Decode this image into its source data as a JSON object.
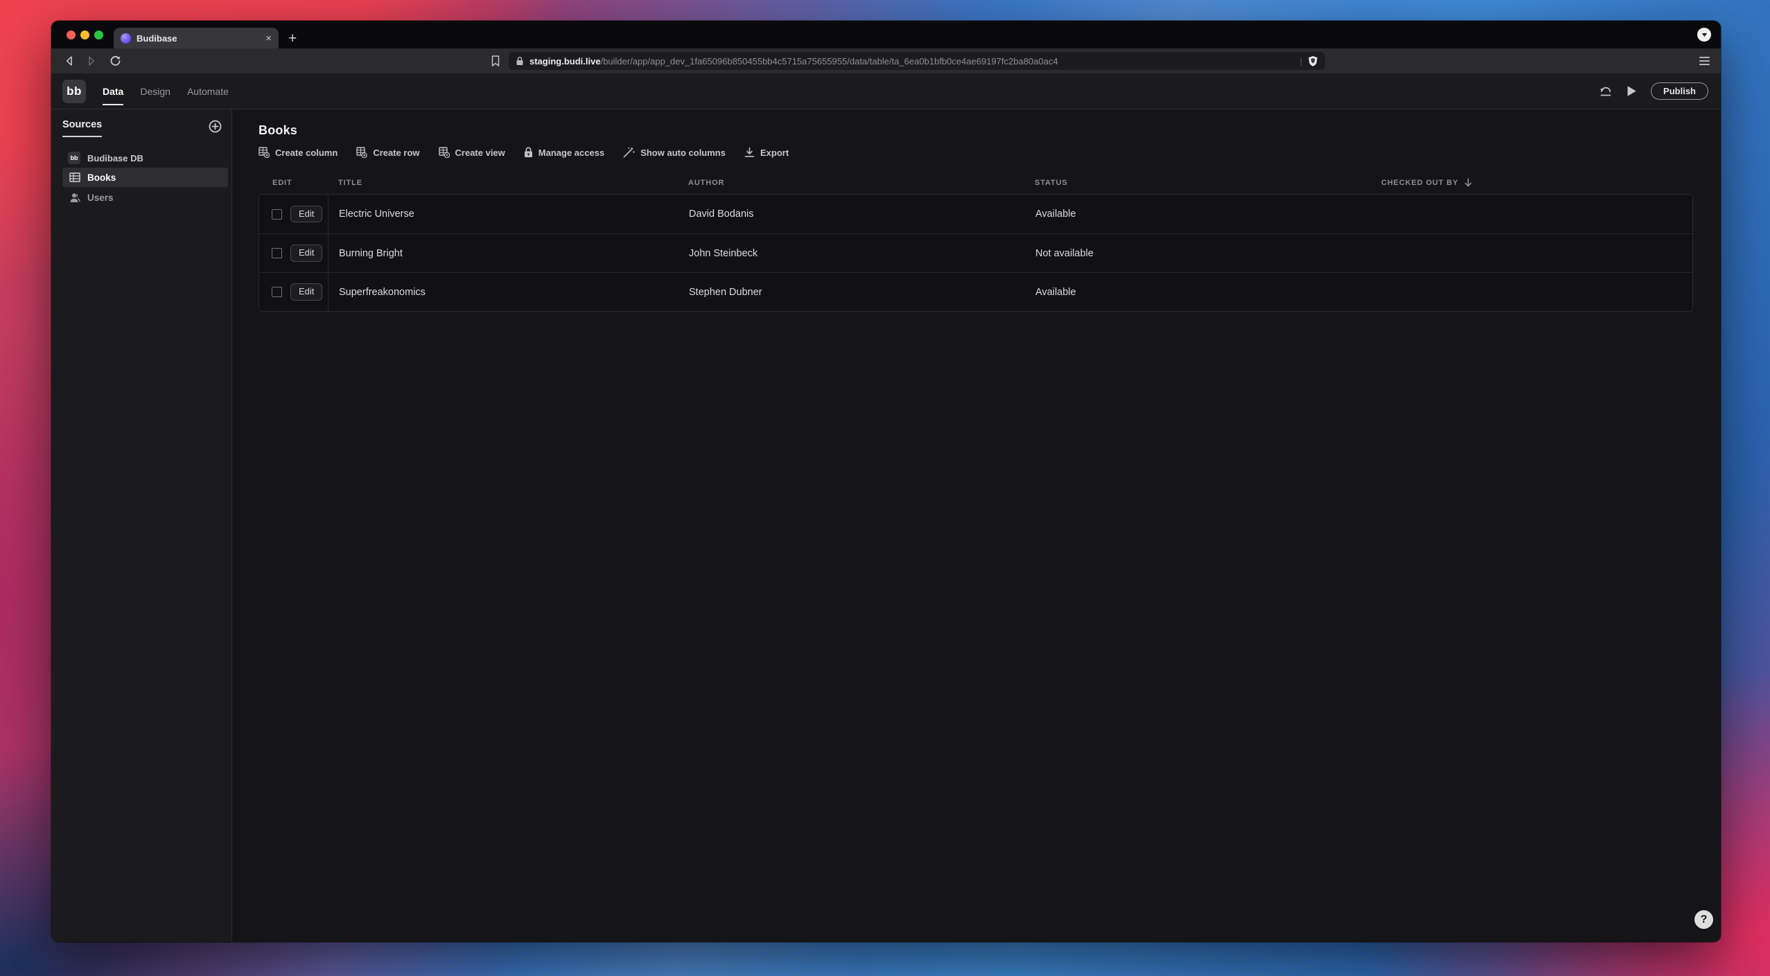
{
  "browser": {
    "tab_title": "Budibase",
    "close_tab_label": "×",
    "new_tab_label": "+",
    "url_domain": "staging.budi.live",
    "url_path": "/builder/app/app_dev_1fa65096b850455bb4c5715a75655955/data/table/ta_6ea0b1bfb0ce4ae69197fc2ba80a0ac4",
    "url_separator": "|"
  },
  "colors": {
    "traffic_close": "#ff5f57",
    "traffic_minimize": "#febc2e",
    "traffic_zoom": "#28c840",
    "favicon": "#6e5cf6",
    "selected_item_bg": "#2f2f33"
  },
  "app": {
    "logo_text": "bb",
    "nav": {
      "tabs": [
        {
          "label": "Data",
          "active": true
        },
        {
          "label": "Design",
          "active": false
        },
        {
          "label": "Automate",
          "active": false
        }
      ]
    },
    "publish_label": "Publish"
  },
  "sidebar": {
    "title": "Sources",
    "datasource": {
      "label": "Budibase DB",
      "icon_text": "bb"
    },
    "items": [
      {
        "label": "Books",
        "selected": true
      },
      {
        "label": "Users",
        "selected": false
      }
    ]
  },
  "main": {
    "title": "Books",
    "toolbar": [
      {
        "label": "Create column"
      },
      {
        "label": "Create row"
      },
      {
        "label": "Create view"
      },
      {
        "label": "Manage access"
      },
      {
        "label": "Show auto columns"
      },
      {
        "label": "Export"
      }
    ],
    "table": {
      "columns": [
        "EDIT",
        "TITLE",
        "AUTHOR",
        "STATUS",
        "CHECKED OUT BY"
      ],
      "sorted_column": "CHECKED OUT BY",
      "sort_direction": "descending",
      "edit_button_label": "Edit",
      "rows": [
        {
          "title": "Electric Universe",
          "author": "David Bodanis",
          "status": "Available",
          "checked_out_by": ""
        },
        {
          "title": "Burning Bright",
          "author": "John Steinbeck",
          "status": "Not available",
          "checked_out_by": ""
        },
        {
          "title": "Superfreakonomics",
          "author": "Stephen Dubner",
          "status": "Available",
          "checked_out_by": ""
        }
      ]
    },
    "help_label": "?"
  }
}
